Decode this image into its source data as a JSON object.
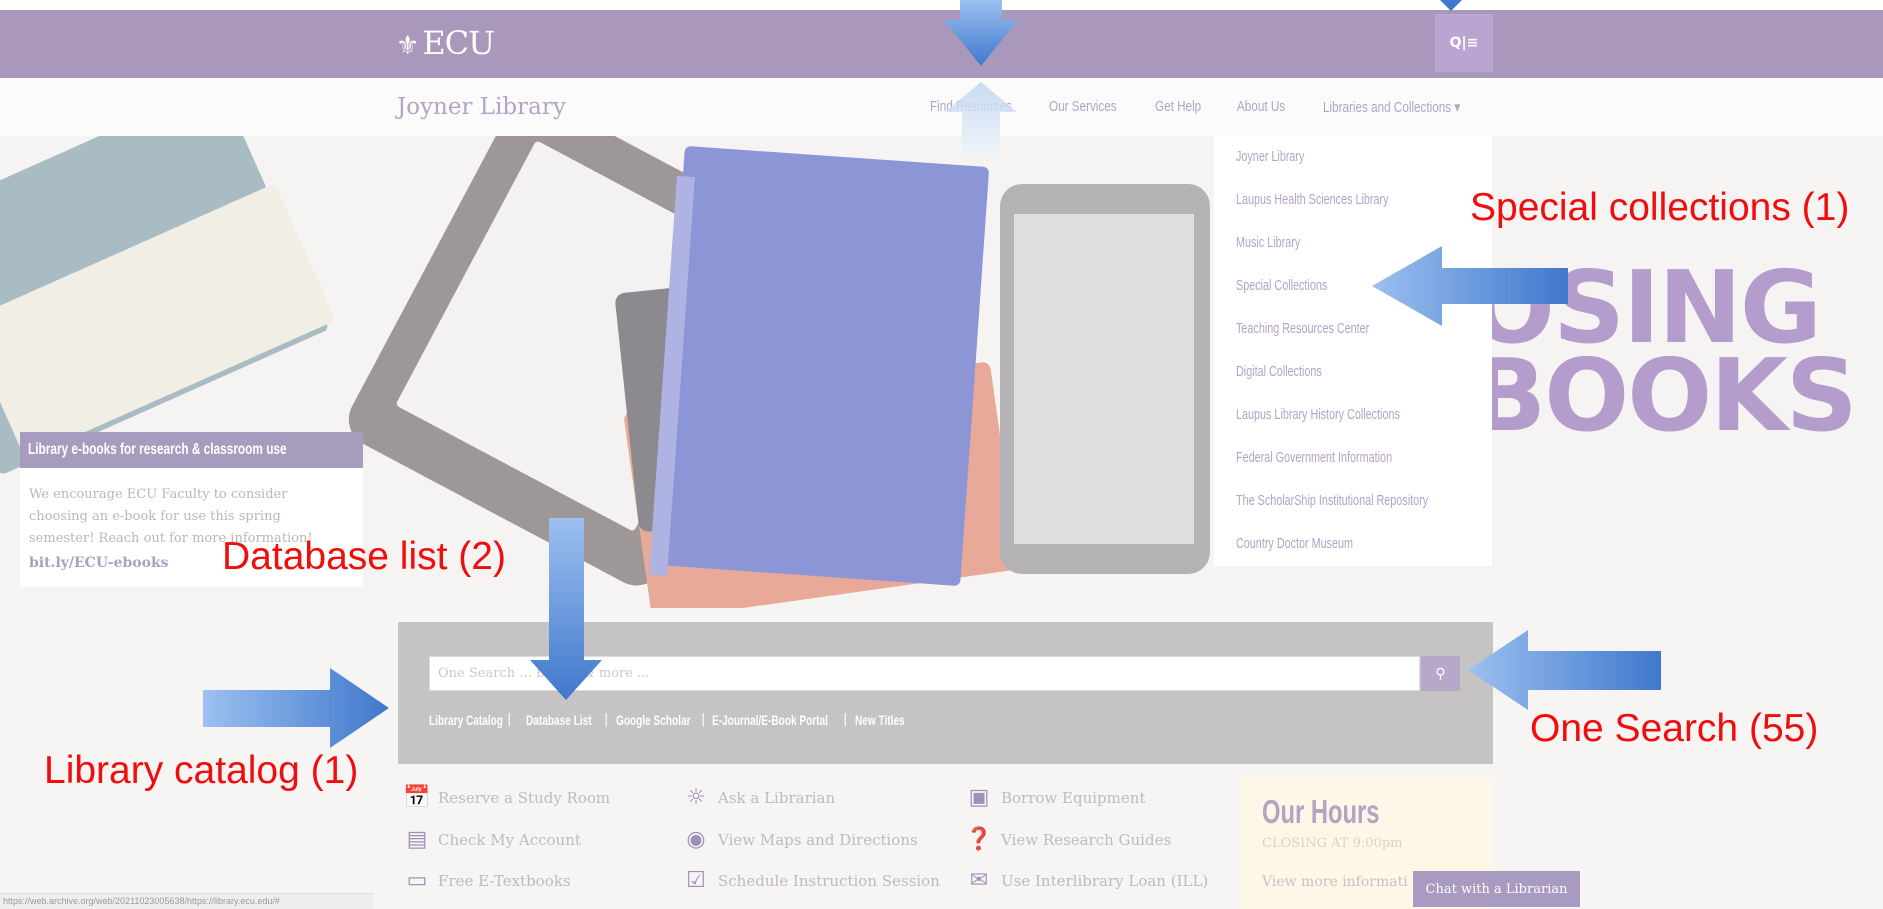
{
  "header": {
    "logo_text": "ECU",
    "logo_seal": "⚜",
    "search_menu_icons": "Q|≡"
  },
  "nav": {
    "brand": "Joyner Library",
    "items": [
      {
        "label": "Find Resources"
      },
      {
        "label": "Our Services"
      },
      {
        "label": "Get Help"
      },
      {
        "label": "About Us"
      },
      {
        "label": "Libraries and Collections ▾"
      }
    ],
    "dropdown": [
      "Joyner Library",
      "Laupus Health Sciences Library",
      "Music Library",
      "Special Collections",
      "Teaching Resources Center",
      "Digital Collections",
      "Laupus Library History Collections",
      "Federal Government Information",
      "The ScholarShip Institutional Repository",
      "Country Doctor Museum"
    ]
  },
  "hero": {
    "banner_text": [
      "OSING",
      "BOOKS"
    ],
    "promo": {
      "heading": "Library e-books for research & classroom use",
      "body": "We encourage ECU Faculty to consider choosing an e-book for use this spring semester! Reach out for more information!",
      "link": "bit.ly/ECU-ebooks"
    }
  },
  "search": {
    "placeholder": "One Search … books, & more ...",
    "quick_links": [
      "Library Catalog",
      "Database List",
      "Google Scholar",
      "E-Journal/E-Book Portal",
      "New Titles"
    ]
  },
  "quick_actions": [
    {
      "label": "Reserve a Study Room",
      "icon": "calendar-icon"
    },
    {
      "label": "Check My Account",
      "icon": "id-card-icon"
    },
    {
      "label": "Free E-Textbooks",
      "icon": "book-icon"
    },
    {
      "label": "Ask a Librarian",
      "icon": "chat-icon"
    },
    {
      "label": "View Maps and Directions",
      "icon": "map-marker-icon"
    },
    {
      "label": "Schedule Instruction Session",
      "icon": "calendar-check-icon"
    },
    {
      "label": "Borrow Equipment",
      "icon": "camera-icon"
    },
    {
      "label": "View Research Guides",
      "icon": "question-icon"
    },
    {
      "label": "Use Interlibrary Loan (ILL)",
      "icon": "envelope-icon"
    }
  ],
  "hours": {
    "title": "Our Hours",
    "closing": "CLOSING AT 9:00pm",
    "more": "View more informati"
  },
  "chat_button": "Chat with a Librarian",
  "status_url": "https://web.archive.org/web/20211023005638/https://library.ecu.edu/#",
  "annotations": {
    "special": "Special collections (1)",
    "database": "Database list (2)",
    "one_search": "One Search (55)",
    "catalog": "Library catalog (1)"
  },
  "colors": {
    "header_purple": "#a998bb",
    "annotation_red": "#f00d0d",
    "arrow_blue": "#4a7fd2"
  }
}
